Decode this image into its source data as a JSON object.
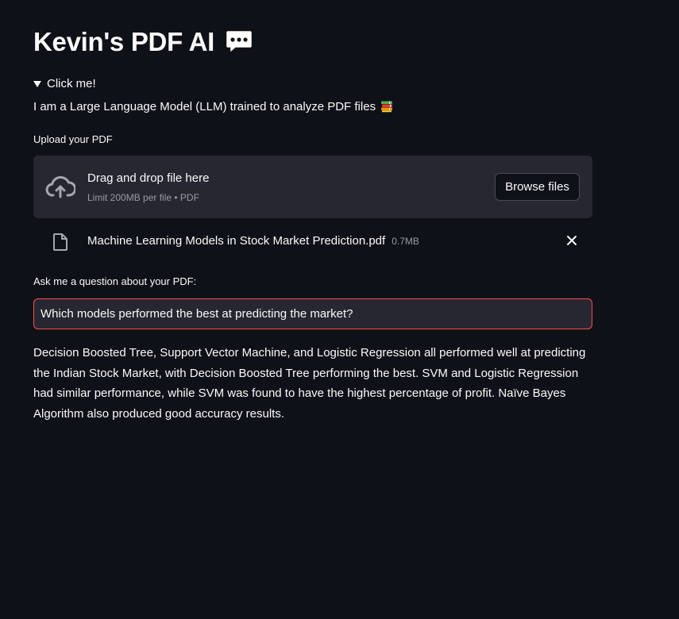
{
  "header": {
    "title": "Kevin's PDF AI",
    "title_icon": "speech-balloon-icon"
  },
  "expander": {
    "label": "Click me!"
  },
  "intro": {
    "text": "I am a Large Language Model (LLM) trained to analyze PDF files",
    "icon": "books-icon"
  },
  "uploader": {
    "label": "Upload your PDF",
    "dropzone_title": "Drag and drop file here",
    "dropzone_subtitle": "Limit 200MB per file • PDF",
    "browse_label": "Browse files",
    "file": {
      "name": "Machine Learning Models in Stock Market Prediction.pdf",
      "size": "0.7MB"
    }
  },
  "question": {
    "label": "Ask me a question about your PDF:",
    "value": "Which models performed the best at predicting the market?"
  },
  "answer": {
    "text": "Decision Boosted Tree, Support Vector Machine, and Logistic Regression all performed well at predicting the Indian Stock Market, with Decision Boosted Tree performing the best. SVM and Logistic Regression had similar performance, while SVM was found to have the highest percentage of profit. Naïve Bayes Algorithm also produced good accuracy results."
  },
  "colors": {
    "background": "#0e1117",
    "surface": "#262730",
    "accent": "#ff4b4b",
    "text": "#fafafa",
    "muted": "#9a9ca3"
  }
}
